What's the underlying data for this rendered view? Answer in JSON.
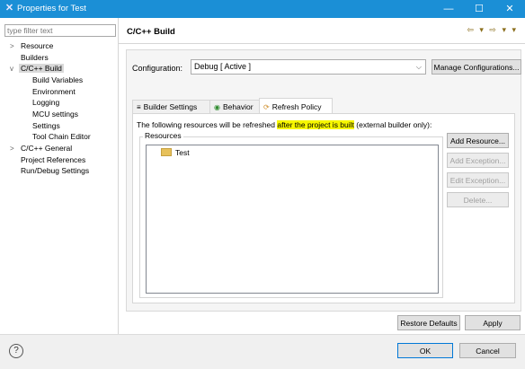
{
  "window": {
    "title": "Properties for Test",
    "controls": [
      "—",
      "☐",
      "✕"
    ]
  },
  "filter": {
    "placeholder": "type filter text"
  },
  "tree": [
    {
      "label": "Resource",
      "twisty": ">"
    },
    {
      "label": "Builders",
      "twisty": ""
    },
    {
      "label": "C/C++ Build",
      "twisty": "v",
      "selected": true
    },
    {
      "label": "Build Variables",
      "twisty": ""
    },
    {
      "label": "Environment",
      "twisty": ""
    },
    {
      "label": "Logging",
      "twisty": ""
    },
    {
      "label": "MCU settings",
      "twisty": ""
    },
    {
      "label": "Settings",
      "twisty": ""
    },
    {
      "label": "Tool Chain Editor",
      "twisty": ""
    },
    {
      "label": "C/C++ General",
      "twisty": ">"
    },
    {
      "label": "Project References",
      "twisty": ""
    },
    {
      "label": "Run/Debug Settings",
      "twisty": ""
    }
  ],
  "page": {
    "title": "C/C++ Build",
    "nav": "⇦ ▾ ⇨ ▾ ▾"
  },
  "config": {
    "label": "Configuration:",
    "value": "Debug  [ Active ]",
    "manage_label": "Manage Configurations..."
  },
  "tabs": [
    {
      "label": "Builder Settings",
      "icon": "≡"
    },
    {
      "label": "Behavior",
      "icon": "◉"
    },
    {
      "label": "Refresh Policy",
      "icon": "⟳",
      "active": true
    }
  ],
  "refresh": {
    "desc_pre": "The following resources will be refreshed ",
    "desc_highlight": "after the project is built",
    "desc_post": " (external builder only):",
    "group_label": "Resources",
    "resource_item": "Test"
  },
  "side_buttons": {
    "add_resource": "Add Resource...",
    "add_exception": "Add Exception...",
    "edit_exception": "Edit Exception...",
    "delete": "Delete..."
  },
  "footer": {
    "restore_defaults": "Restore Defaults",
    "apply": "Apply",
    "ok": "OK",
    "cancel": "Cancel",
    "help_glyph": "?"
  }
}
